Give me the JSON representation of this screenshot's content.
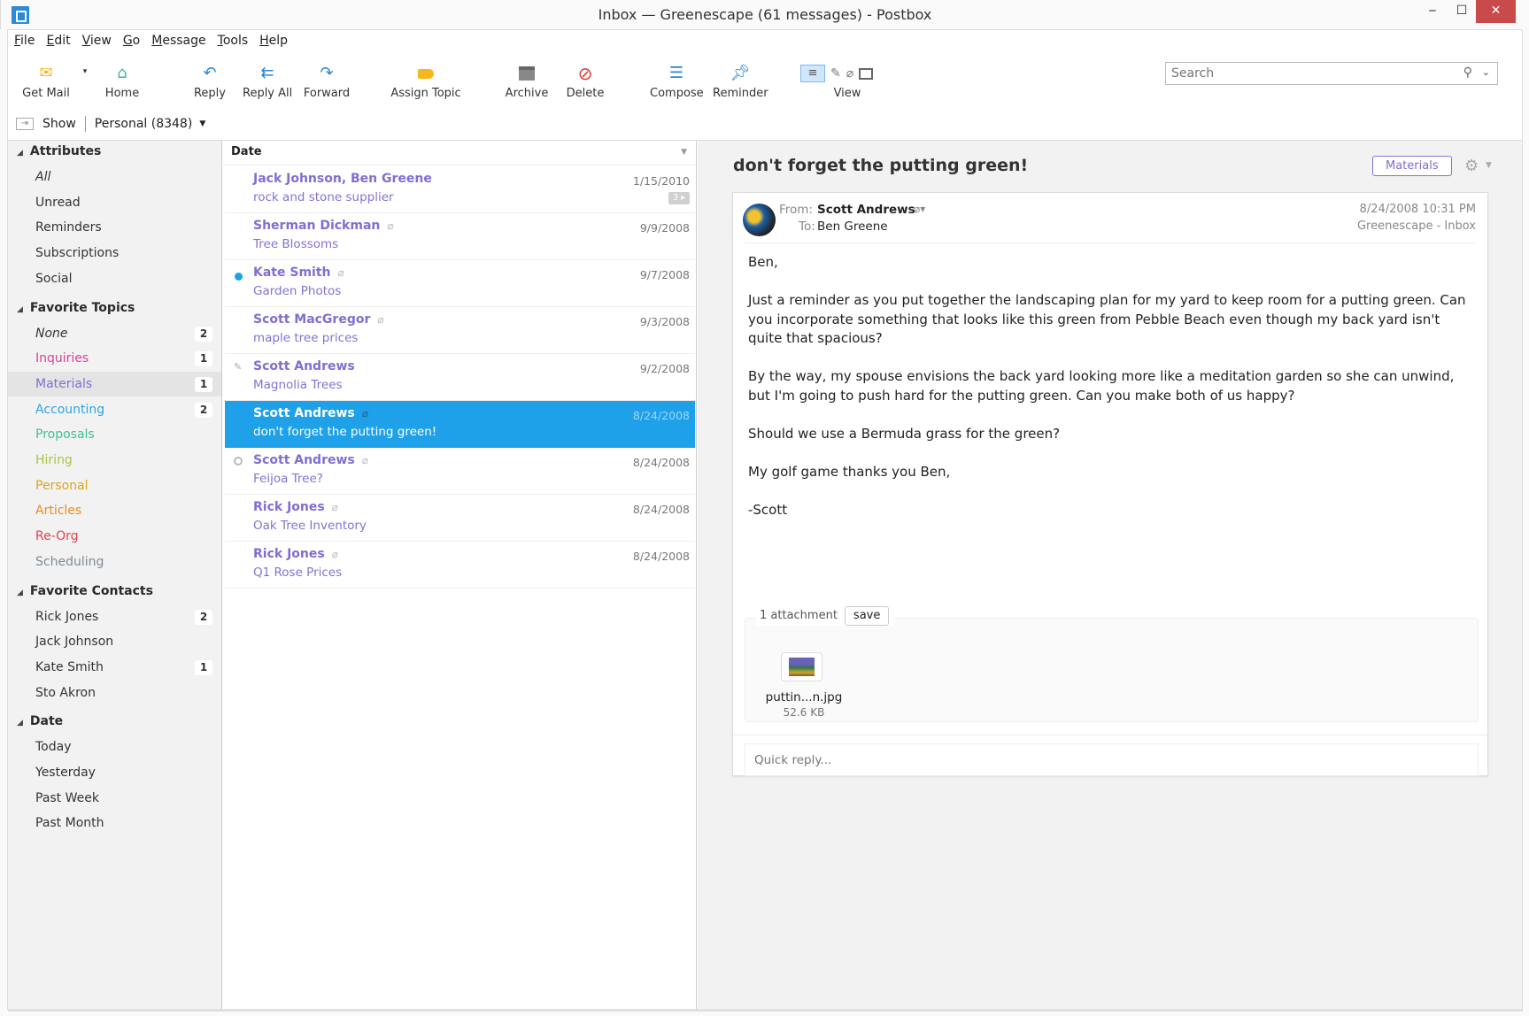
{
  "window": {
    "title": "Inbox — Greenescape (61 messages) - Postbox",
    "minimize": "‒",
    "maximize": "☐",
    "close": "✕"
  },
  "menu": [
    {
      "label": "File",
      "key": "F",
      "rest": "ile"
    },
    {
      "label": "Edit",
      "key": "E",
      "rest": "dit"
    },
    {
      "label": "View",
      "key": "V",
      "rest": "iew"
    },
    {
      "label": "Go",
      "key": "G",
      "rest": "o"
    },
    {
      "label": "Message",
      "key": "M",
      "rest": "essage"
    },
    {
      "label": "Tools",
      "key": "T",
      "rest": "ools"
    },
    {
      "label": "Help",
      "key": "H",
      "rest": "elp"
    }
  ],
  "toolbar": {
    "get_mail": "Get Mail",
    "home": "Home",
    "reply": "Reply",
    "reply_all": "Reply All",
    "forward": "Forward",
    "assign_topic": "Assign Topic",
    "archive": "Archive",
    "delete": "Delete",
    "compose": "Compose",
    "reminder": "Reminder",
    "view": "View"
  },
  "search": {
    "placeholder": "Search",
    "value": ""
  },
  "showbar": {
    "show_label": "Show",
    "account": "Personal (8348)"
  },
  "sidebar": {
    "sections": [
      {
        "title": "Attributes",
        "items": [
          {
            "label": "All",
            "italic": true
          },
          {
            "label": "Unread"
          },
          {
            "label": "Reminders"
          },
          {
            "label": "Subscriptions"
          },
          {
            "label": "Social"
          }
        ]
      },
      {
        "title": "Favorite Topics",
        "items": [
          {
            "label": "None",
            "italic": true,
            "count": "2"
          },
          {
            "label": "Inquiries",
            "color": "#e0409a",
            "count": "1"
          },
          {
            "label": "Materials",
            "color": "#7d6fd4",
            "count": "1",
            "selected": true
          },
          {
            "label": "Accounting",
            "color": "#2fa3e6",
            "count": "2"
          },
          {
            "label": "Proposals",
            "color": "#3dbf9b"
          },
          {
            "label": "Hiring",
            "color": "#a8c44a"
          },
          {
            "label": "Personal",
            "color": "#e0a020"
          },
          {
            "label": "Articles",
            "color": "#f08a24"
          },
          {
            "label": "Re-Org",
            "color": "#e8404f"
          },
          {
            "label": "Scheduling",
            "color": "#7d8a96"
          }
        ]
      },
      {
        "title": "Favorite Contacts",
        "items": [
          {
            "label": "Rick Jones",
            "count": "2"
          },
          {
            "label": "Jack Johnson"
          },
          {
            "label": "Kate Smith",
            "count": "1"
          },
          {
            "label": "Sto Akron"
          }
        ]
      },
      {
        "title": "Date",
        "items": [
          {
            "label": "Today"
          },
          {
            "label": "Yesterday"
          },
          {
            "label": "Past Week"
          },
          {
            "label": "Past Month"
          }
        ]
      }
    ]
  },
  "message_list": {
    "sort_column": "Date",
    "rows": [
      {
        "from": "Jack Johnson, Ben Greene",
        "subject": "rock and stone supplier",
        "date": "1/15/2010",
        "thread_count": "3 ▸"
      },
      {
        "from": "Sherman Dickman",
        "subject": "Tree Blossoms",
        "date": "9/9/2008",
        "attachment": true
      },
      {
        "from": "Kate Smith",
        "subject": "Garden Photos",
        "date": "9/7/2008",
        "attachment": true,
        "unread": true
      },
      {
        "from": "Scott MacGregor",
        "subject": "maple tree prices",
        "date": "9/3/2008",
        "attachment": true
      },
      {
        "from": "Scott Andrews",
        "subject": "Magnolia Trees",
        "date": "9/2/2008",
        "reminder": true
      },
      {
        "from": "Scott Andrews",
        "subject": "don't forget the putting green!",
        "date": "8/24/2008",
        "attachment": true,
        "selected": true
      },
      {
        "from": "Scott Andrews",
        "subject": "Feijoa Tree?",
        "date": "8/24/2008",
        "attachment": true,
        "snoozed": true
      },
      {
        "from": "Rick Jones",
        "subject": "Oak Tree Inventory",
        "date": "8/24/2008",
        "attachment": true
      },
      {
        "from": "Rick Jones",
        "subject": "Q1 Rose Prices",
        "date": "8/24/2008",
        "attachment": true
      }
    ]
  },
  "reader": {
    "subject": "don't forget the putting green!",
    "topic_tag": "Materials",
    "from_label": "From:",
    "from": "Scott Andrews",
    "to_label": "To:",
    "to": "Ben Greene",
    "datetime": "8/24/2008 10:31 PM",
    "folder": "Greenescape - Inbox",
    "body": [
      "Ben,",
      "Just a reminder as you put together the landscaping plan for my yard to keep room for a putting green. Can you incorporate something that looks like this green from Pebble Beach even though my back yard isn't quite that spacious?",
      "By the way, my spouse envisions the back yard looking more like a meditation garden so she can unwind, but I'm going to push hard for the putting green. Can you make both of us happy?",
      "Should we use a Bermuda grass for the green?",
      "My golf game thanks you Ben,",
      "-Scott"
    ],
    "attachments_label": "1 attachment",
    "save_label": "save",
    "attachment": {
      "name": "puttin...n.jpg",
      "size": "52.6 KB"
    },
    "quick_reply_placeholder": "Quick reply..."
  },
  "colors": {
    "accent": "#1ea1e8",
    "sender": "#7d6fd4",
    "close_button": "#c94a4a"
  }
}
